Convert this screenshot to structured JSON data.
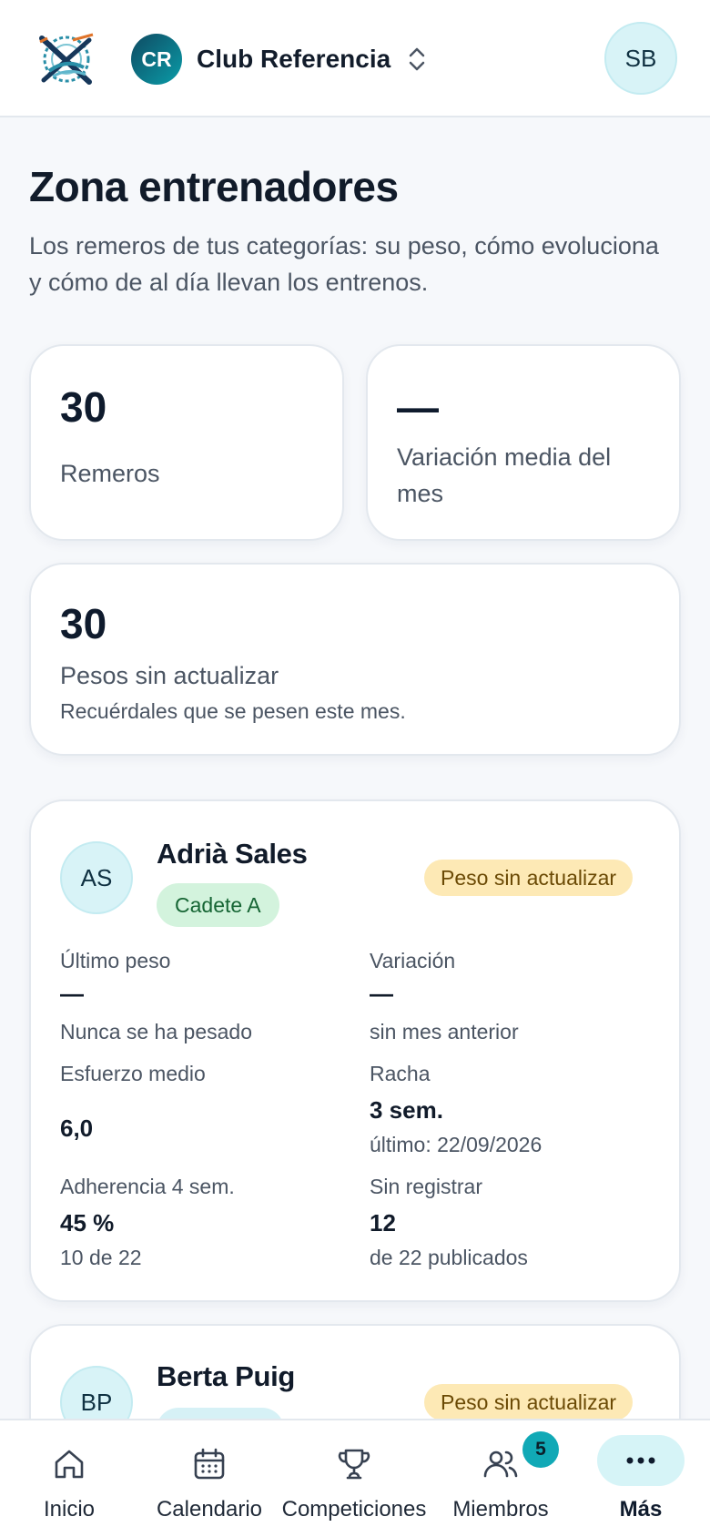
{
  "header": {
    "club_initials": "CR",
    "club_name": "Club Referencia",
    "user_initials": "SB"
  },
  "page": {
    "title": "Zona entrenadores",
    "subtitle": "Los remeros de tus categorías: su peso, cómo evoluciona y cómo de al día llevan los entrenos."
  },
  "stats": {
    "rowers_value": "30",
    "rowers_label": "Remeros",
    "variation_value": "—",
    "variation_label": "Variación media del mes",
    "outdated_value": "30",
    "outdated_label": "Pesos sin actualizar",
    "outdated_hint": "Recuérdales que se pesen este mes."
  },
  "rowers": [
    {
      "initials": "AS",
      "name": "Adrià Sales",
      "category": "Cadete A",
      "status": "Peso sin actualizar",
      "last_weight_label": "Último peso",
      "last_weight_value": "—",
      "last_weight_sub": "Nunca se ha pesado",
      "variation_label": "Variación",
      "variation_value": "—",
      "variation_sub": "sin mes anterior",
      "effort_label": "Esfuerzo medio",
      "effort_value": "6,0",
      "streak_label": "Racha",
      "streak_value": "3 sem.",
      "streak_sub": "último: 22/09/2026",
      "adherence_label": "Adherencia 4 sem.",
      "adherence_value": "45 %",
      "adherence_sub": "10 de 22",
      "unregistered_label": "Sin registrar",
      "unregistered_value": "12",
      "unregistered_sub": "de 22 publicados"
    },
    {
      "initials": "BP",
      "name": "Berta Puig",
      "status": "Peso sin actualizar"
    }
  ],
  "nav": {
    "items": [
      "Inicio",
      "Calendario",
      "Competiciones",
      "Miembros",
      "Más"
    ],
    "members_badge": "5"
  },
  "colors": {
    "accent": "#11a9b6",
    "category_bg": "#d3f3dd",
    "warning_bg": "#fde9b5"
  }
}
